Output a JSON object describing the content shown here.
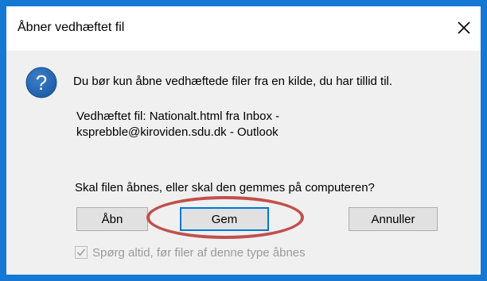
{
  "dialog": {
    "title": "Åbner vedhæftet fil",
    "message": "Du bør kun åbne vedhæftede filer fra en kilde, du har tillid til.",
    "attachment_line1": "Vedhæftet fil: Nationalt.html fra Inbox -",
    "attachment_line2": "ksprebble@kiroviden.sdu.dk - Outlook",
    "question": "Skal filen åbnes, eller skal den gemmes på computeren?",
    "buttons": {
      "open": "Åbn",
      "save": "Gem",
      "cancel": "Annuller"
    },
    "checkbox_label": "Spørg altid, før filer af denne type åbnes",
    "checkbox_checked": true
  },
  "icons": {
    "close": "close-icon",
    "question": "question-icon",
    "checkmark": "checkmark-icon"
  },
  "colors": {
    "desktop_background": "#1478d4",
    "dialog_background": "#f0f0f0",
    "question_icon": "#1f5fa8",
    "focus_border": "#0078d7",
    "highlight_ellipse": "#c0504d",
    "disabled_text": "#9a9a9a"
  }
}
